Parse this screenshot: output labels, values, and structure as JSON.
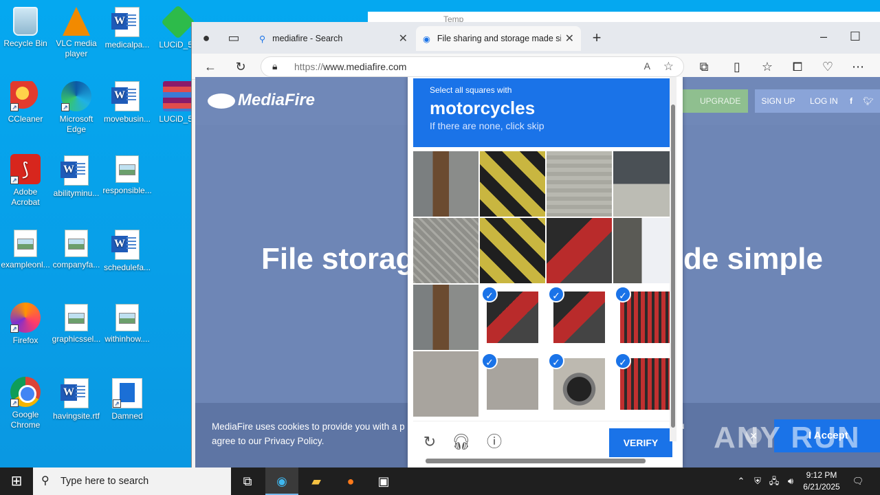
{
  "desktop": {
    "icons": [
      {
        "label": "Recycle Bin"
      },
      {
        "label": "VLC media player"
      },
      {
        "label": "medicalpa..."
      },
      {
        "label": "LUCiD_5e"
      },
      {
        "label": "CCleaner"
      },
      {
        "label": "Microsoft Edge"
      },
      {
        "label": "movebusin..."
      },
      {
        "label": "LUCiD_5e"
      },
      {
        "label": "Adobe Acrobat"
      },
      {
        "label": "abilityminu..."
      },
      {
        "label": "responsible..."
      },
      {
        "label": "exampleonl..."
      },
      {
        "label": "companyfa..."
      },
      {
        "label": "schedulefa..."
      },
      {
        "label": "Firefox"
      },
      {
        "label": "graphicssel..."
      },
      {
        "label": "withinhow...."
      },
      {
        "label": "Google Chrome"
      },
      {
        "label": "havingsite.rtf"
      },
      {
        "label": "Damned"
      }
    ]
  },
  "background_window": {
    "title": "Temp"
  },
  "browser": {
    "tabs": [
      {
        "label": "mediafire - Search",
        "icon": "search-icon"
      },
      {
        "label": "File sharing and storage made sir",
        "icon": "edge-icon"
      }
    ],
    "new_tab": "+",
    "url_protocol": "https://",
    "url_host": "www.mediafire.com"
  },
  "mediafire": {
    "logo": "MediaFire",
    "upgrade": "UPGRADE",
    "signup": "SIGN UP",
    "login": "LOG IN",
    "social": "f",
    "hero_left": "File storag",
    "hero_right": "de simple",
    "cookie_text": "MediaFire uses cookies to provide you with a p agree to our Privacy Policy.",
    "cookie_fragment": "u",
    "accept": "I Accept"
  },
  "captcha": {
    "instruction": "Select all squares with",
    "target": "motorcycles",
    "hint": "If there are none, click skip",
    "verify": "VERIFY",
    "selected_cells": [
      9,
      10,
      11,
      13,
      14,
      15
    ]
  },
  "taskbar": {
    "search_placeholder": "Type here to search",
    "time": "9:12 PM",
    "date": "6/21/2025"
  },
  "watermark": "ANY RUN"
}
